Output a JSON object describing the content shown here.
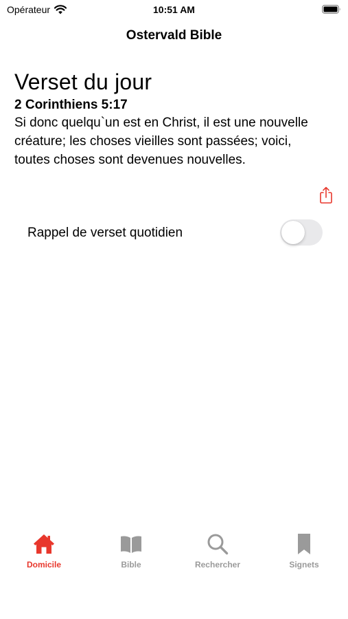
{
  "status_bar": {
    "carrier": "Opérateur",
    "time": "10:51 AM"
  },
  "nav": {
    "title": "Ostervald Bible"
  },
  "verse": {
    "heading": "Verset du jour",
    "reference": "2 Corinthiens 5:17",
    "text": "Si donc quelqu`un est en Christ, il est une nouvelle créature; les choses vieilles sont passées; voici, toutes choses sont devenues nouvelles."
  },
  "reminder": {
    "label": "Rappel de verset quotidien",
    "enabled": false
  },
  "tabs": [
    {
      "label": "Domicile",
      "icon": "home-icon",
      "active": true
    },
    {
      "label": "Bible",
      "icon": "book-icon",
      "active": false
    },
    {
      "label": "Rechercher",
      "icon": "search-icon",
      "active": false
    },
    {
      "label": "Signets",
      "icon": "bookmark-icon",
      "active": false
    }
  ],
  "colors": {
    "accent": "#e8372c",
    "inactive": "#9a9a9a",
    "toggle_off": "#e9e9eb"
  }
}
